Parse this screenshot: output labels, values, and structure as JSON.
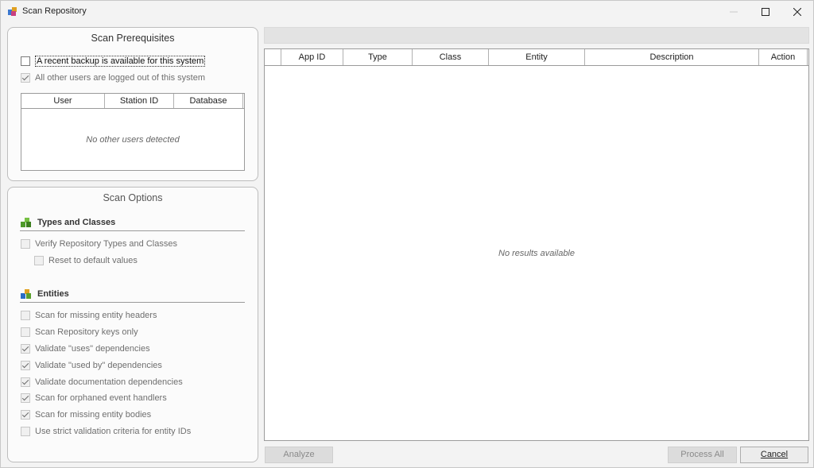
{
  "window": {
    "title": "Scan Repository"
  },
  "prerequisites": {
    "title": "Scan Prerequisites",
    "items": [
      {
        "label": "A recent backup is available for this system",
        "checked": false,
        "enabled": true
      },
      {
        "label": "All other users are logged out of this system",
        "checked": true,
        "enabled": false
      }
    ],
    "users_table": {
      "columns": [
        "User",
        "Station ID",
        "Database"
      ],
      "empty_message": "No other users detected"
    }
  },
  "options": {
    "title": "Scan Options",
    "types_section": {
      "heading": "Types and Classes",
      "items": [
        {
          "label": "Verify Repository Types and Classes",
          "checked": false,
          "enabled": false
        },
        {
          "label": "Reset to default values",
          "checked": false,
          "enabled": false
        }
      ]
    },
    "entities_section": {
      "heading": "Entities",
      "items": [
        {
          "label": "Scan for missing entity headers",
          "checked": false,
          "enabled": false
        },
        {
          "label": "Scan Repository keys only",
          "checked": false,
          "enabled": false
        },
        {
          "label": "Validate \"uses\" dependencies",
          "checked": true,
          "enabled": false
        },
        {
          "label": "Validate \"used by\" dependencies",
          "checked": true,
          "enabled": false
        },
        {
          "label": "Validate documentation dependencies",
          "checked": true,
          "enabled": false
        },
        {
          "label": "Scan for orphaned event handlers",
          "checked": true,
          "enabled": false
        },
        {
          "label": "Scan for missing entity bodies",
          "checked": true,
          "enabled": false
        },
        {
          "label": "Use strict validation criteria for entity IDs",
          "checked": false,
          "enabled": false
        }
      ]
    }
  },
  "results": {
    "columns": [
      "",
      "App ID",
      "Type",
      "Class",
      "Entity",
      "Description",
      "Action"
    ],
    "empty_message": "No results available"
  },
  "buttons": {
    "analyze": "Analyze",
    "process_all": "Process All",
    "cancel": "Cancel"
  },
  "colors": {
    "accent_green": "#5aa02c",
    "accent_blue": "#2b6cc4",
    "disabled_button": "#dcdcdc"
  }
}
